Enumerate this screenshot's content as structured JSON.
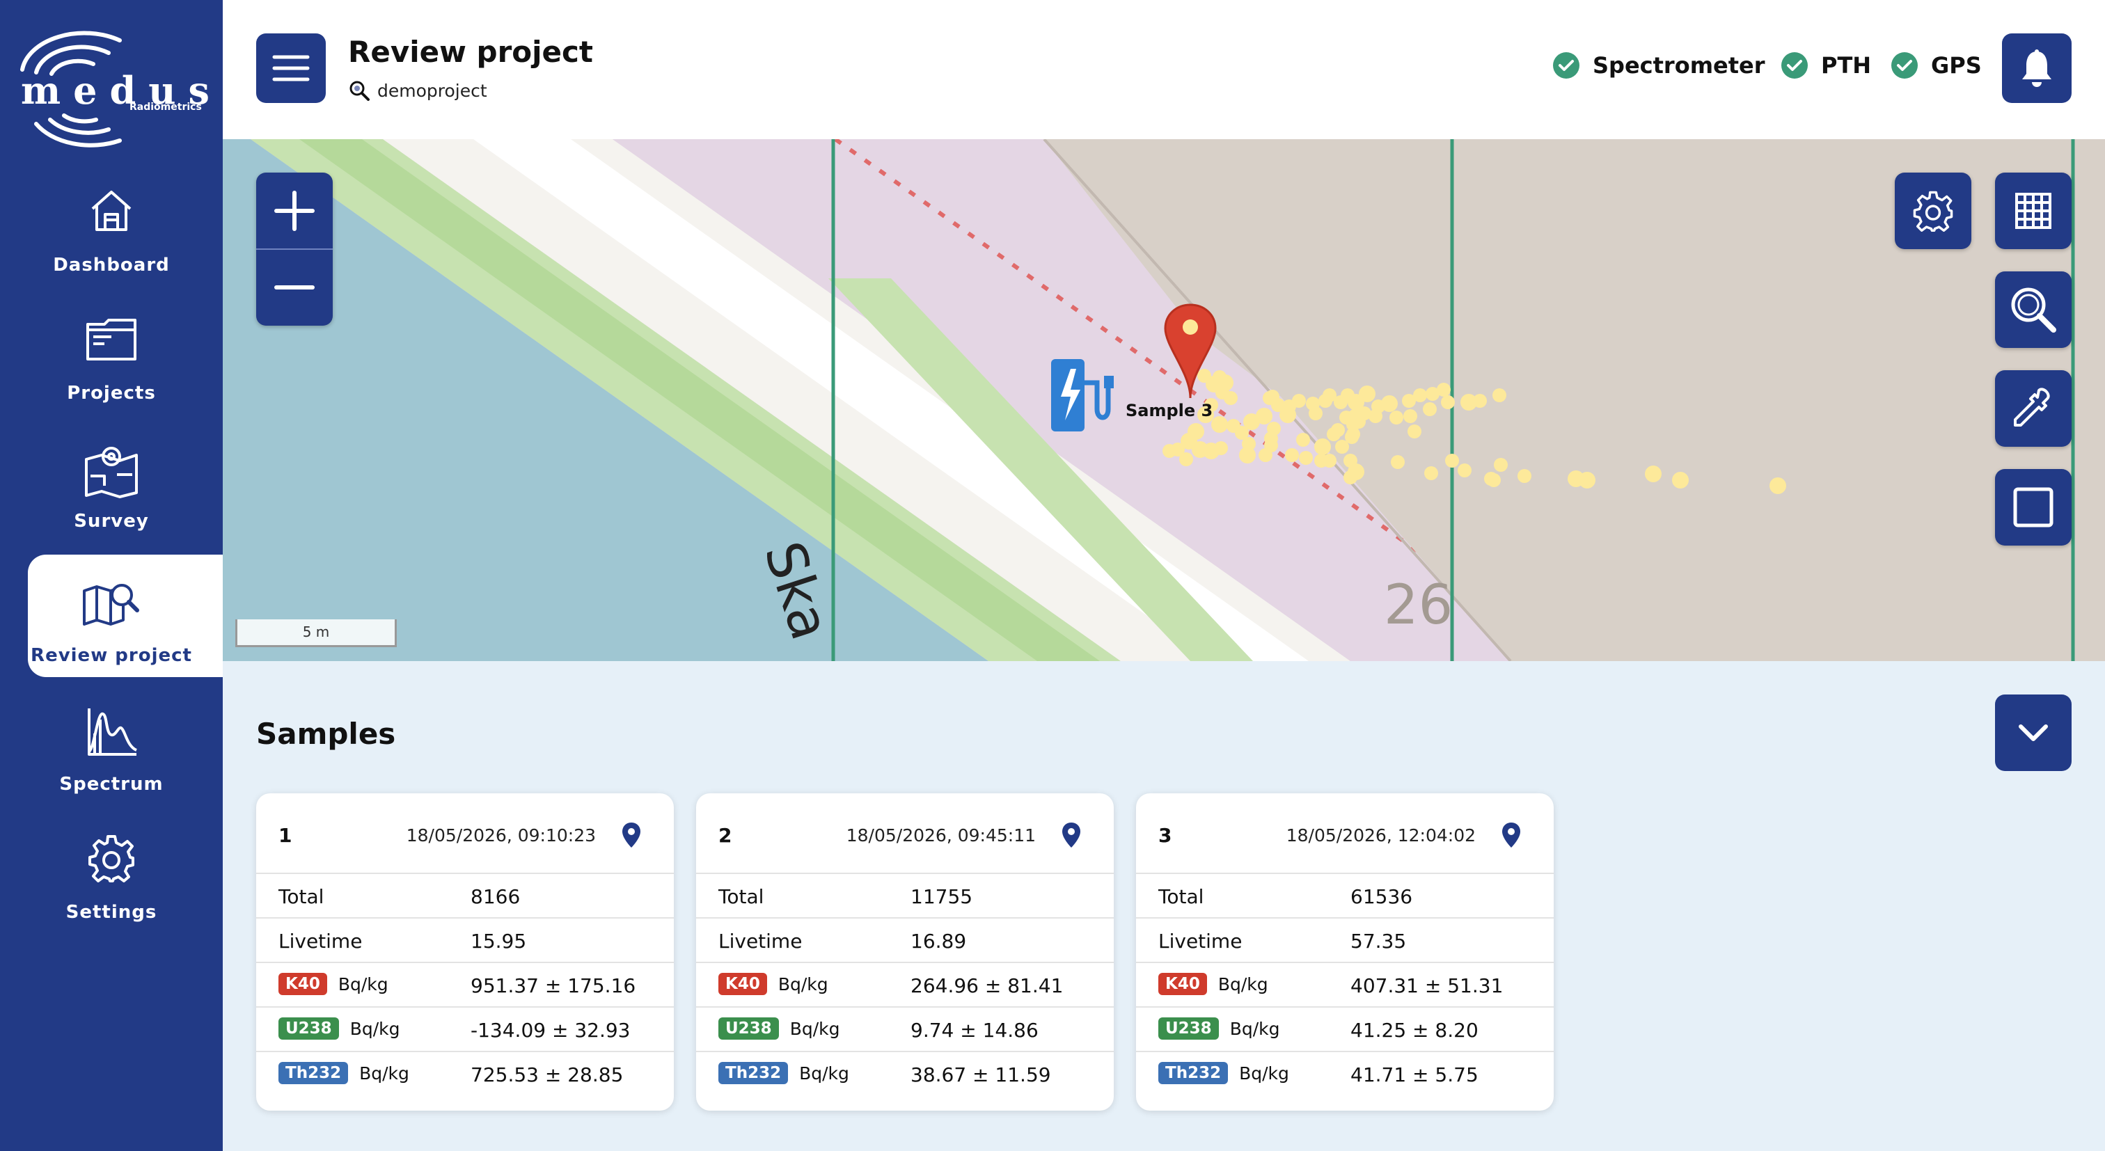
{
  "app": {
    "logo_text": "medusa",
    "logo_subtext": "Radiometrics"
  },
  "sidebar": {
    "items": [
      {
        "label": "Dashboard",
        "icon": "home-icon",
        "active": false
      },
      {
        "label": "Projects",
        "icon": "folder-icon",
        "active": false
      },
      {
        "label": "Survey",
        "icon": "survey-map-icon",
        "active": false
      },
      {
        "label": "Review project",
        "icon": "map-search-icon",
        "active": true
      },
      {
        "label": "Spectrum",
        "icon": "spectrum-chart-icon",
        "active": false
      },
      {
        "label": "Settings",
        "icon": "gear-icon",
        "active": false
      }
    ]
  },
  "header": {
    "title": "Review project",
    "project": "demoproject",
    "status": [
      {
        "label": "Spectrometer",
        "ok": true
      },
      {
        "label": "PTH",
        "ok": true
      },
      {
        "label": "GPS",
        "ok": true
      }
    ]
  },
  "map": {
    "scale_label": "5 m",
    "house_number": "26",
    "street_fragment": "Ska",
    "sample_marker_label": "Sample 3",
    "point_color": "#fde99a",
    "marker_color": "#d9412f"
  },
  "samples": {
    "title": "Samples",
    "labels": {
      "total": "Total",
      "livetime": "Livetime",
      "unit": "Bq/kg",
      "k40": "K40",
      "u238": "U238",
      "th232": "Th232"
    },
    "cards": [
      {
        "id": "1",
        "datetime": "18/05/2026, 09:10:23",
        "total": "8166",
        "livetime": "15.95",
        "k40": "951.37 ± 175.16",
        "u238": "-134.09 ± 32.93",
        "th232": "725.53 ± 28.85"
      },
      {
        "id": "2",
        "datetime": "18/05/2026, 09:45:11",
        "total": "11755",
        "livetime": "16.89",
        "k40": "264.96 ± 81.41",
        "u238": "9.74 ± 14.86",
        "th232": "38.67 ± 11.59"
      },
      {
        "id": "3",
        "datetime": "18/05/2026, 12:04:02",
        "total": "61536",
        "livetime": "57.35",
        "k40": "407.31 ± 51.31",
        "u238": "41.25 ± 8.20",
        "th232": "41.71 ± 5.75"
      }
    ]
  },
  "colors": {
    "primary": "#223a86",
    "status_ok": "#3a9a78",
    "k40": "#cf3b2c",
    "u238": "#3b8f4d",
    "th232": "#3b70b4",
    "panel_bg": "#e6f0f8"
  }
}
